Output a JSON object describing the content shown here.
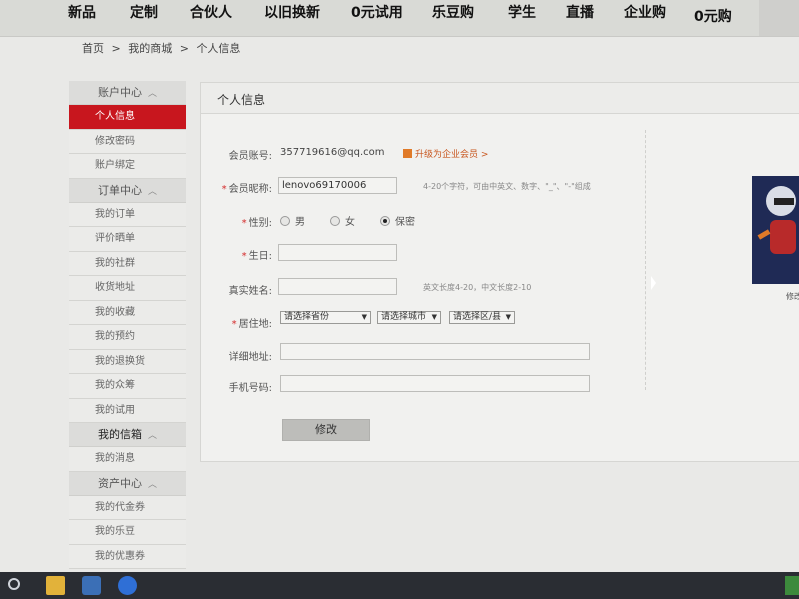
{
  "topnav": {
    "items": [
      "新品",
      "定制",
      "合伙人",
      "以旧换新",
      "0元试用",
      "乐豆购",
      "学生",
      "直播",
      "企业购",
      "0元购"
    ]
  },
  "breadcrumb": [
    "首页",
    ">",
    "我的商城",
    ">",
    "个人信息"
  ],
  "sidebar": {
    "sections": [
      {
        "title": "账户中心",
        "items": [
          "个人信息",
          "修改密码",
          "账户绑定"
        ]
      },
      {
        "title": "订单中心",
        "items": [
          "我的订单",
          "评价晒单",
          "我的社群",
          "收货地址",
          "我的收藏",
          "我的预约",
          "我的退换货",
          "我的众筹",
          "我的试用"
        ]
      },
      {
        "title": "我的信箱",
        "items": [
          "我的消息"
        ]
      },
      {
        "title": "资产中心",
        "items": [
          "我的代金券",
          "我的乐豆",
          "我的优惠券"
        ]
      }
    ],
    "active": "个人信息"
  },
  "panel": {
    "title": "个人信息",
    "account_label": "会员账号:",
    "account_value": "357719616@qq.com",
    "upgrade_text": "升级为企业会员 >",
    "nickname_label": "会员昵称:",
    "nickname_value": "lenovo69170006",
    "nickname_hint": "4-20个字符，可由中英文、数字、\"_\"、\"-\"组成",
    "gender_label": "性别:",
    "gender_options": [
      "男",
      "女",
      "保密"
    ],
    "gender_selected": "保密",
    "birthday_label": "生日:",
    "realname_label": "真实姓名:",
    "realname_hint": "英文长度4-20，中文长度2-10",
    "residence_label": "居住地:",
    "province_placeholder": "请选择省份",
    "city_placeholder": "请选择城市",
    "district_placeholder": "请选择区/县",
    "address_label": "详细地址:",
    "phone_label": "手机号码:",
    "submit_label": "修改"
  },
  "avatar": {
    "caption": "修改"
  }
}
